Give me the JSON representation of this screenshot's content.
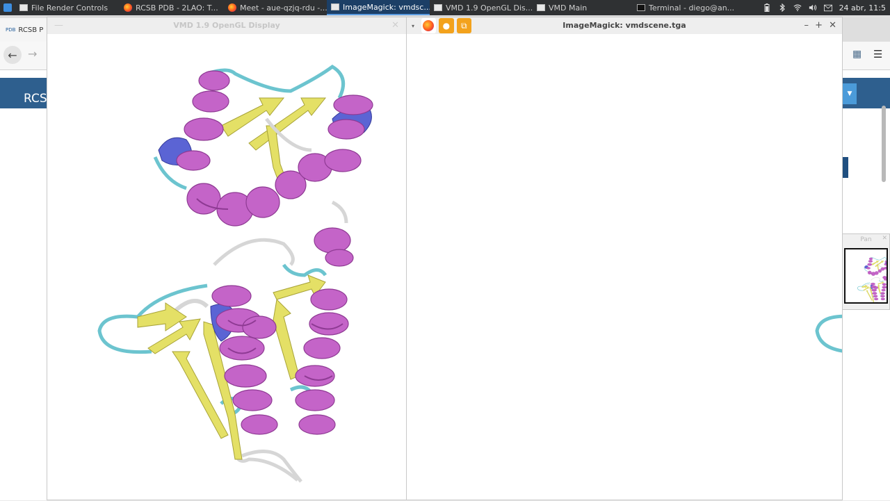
{
  "taskbar": {
    "tasks": [
      {
        "label": "File Render Controls",
        "icon": "window-icon"
      },
      {
        "label": "RCSB PDB - 2LAO: T...",
        "icon": "firefox-icon"
      },
      {
        "label": "Meet - aue-qzjq-rdu -...",
        "icon": "firefox-icon"
      },
      {
        "label": "ImageMagick: vmdsc...",
        "icon": "window-icon"
      },
      {
        "label": "VMD 1.9 OpenGL Dis...",
        "icon": "window-icon"
      },
      {
        "label": "VMD Main",
        "icon": "window-icon"
      },
      {
        "label": "Terminal - diego@an...",
        "icon": "terminal-icon"
      }
    ],
    "clock": "24 abr, 11:5"
  },
  "browser": {
    "tab_label": "RCSB P",
    "banner_text": "RCSI"
  },
  "vmd_window": {
    "title": "VMD 1.9 OpenGL Display"
  },
  "imagemagick_window": {
    "title": "ImageMagick: vmdscene.tga"
  },
  "pan_window": {
    "title": "Pan"
  },
  "colors": {
    "helix": "#c464c8",
    "helix_dark": "#8e3a93",
    "sheet": "#e4e066",
    "sheet_dark": "#a7a237",
    "turn": "#6cc4cf",
    "coil": "#d6d6d6",
    "helix_310": "#5b64d4",
    "active_task": "#1c3f66",
    "rcsb_blue": "#2e5f8e"
  }
}
